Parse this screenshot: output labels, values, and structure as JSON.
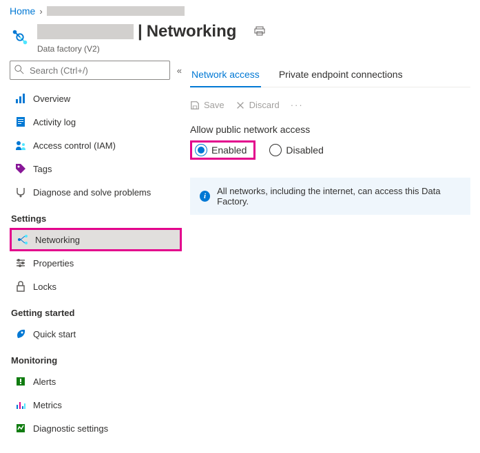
{
  "breadcrumb": {
    "home": "Home"
  },
  "header": {
    "separator": "|",
    "title": "Networking",
    "subtitle": "Data factory (V2)"
  },
  "sidebar": {
    "search_placeholder": "Search (Ctrl+/)",
    "items_top": [
      {
        "label": "Overview"
      },
      {
        "label": "Activity log"
      },
      {
        "label": "Access control (IAM)"
      },
      {
        "label": "Tags"
      },
      {
        "label": "Diagnose and solve problems"
      }
    ],
    "settings_header": "Settings",
    "items_settings": [
      {
        "label": "Networking"
      },
      {
        "label": "Properties"
      },
      {
        "label": "Locks"
      }
    ],
    "getting_started_header": "Getting started",
    "items_getting": [
      {
        "label": "Quick start"
      }
    ],
    "monitoring_header": "Monitoring",
    "items_monitoring": [
      {
        "label": "Alerts"
      },
      {
        "label": "Metrics"
      },
      {
        "label": "Diagnostic settings"
      }
    ]
  },
  "content": {
    "tabs": [
      {
        "label": "Network access"
      },
      {
        "label": "Private endpoint connections"
      }
    ],
    "toolbar": {
      "save": "Save",
      "discard": "Discard"
    },
    "allow_label": "Allow public network access",
    "radio": {
      "enabled": "Enabled",
      "disabled": "Disabled"
    },
    "info": "All networks, including the internet, can access this Data Factory."
  }
}
